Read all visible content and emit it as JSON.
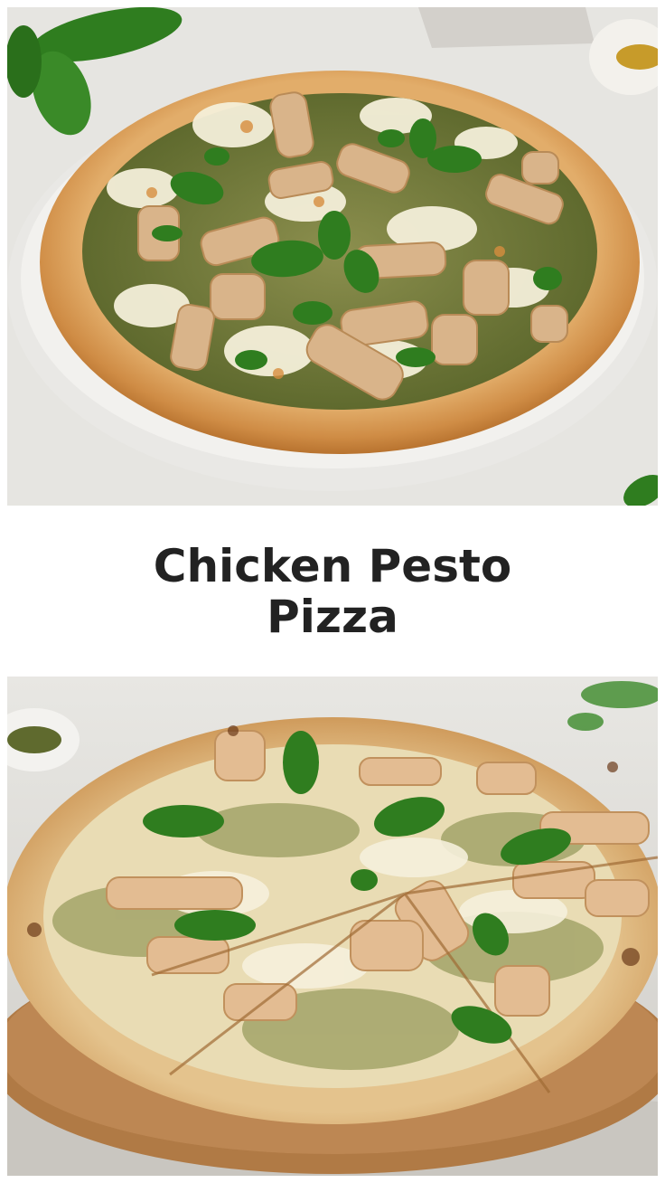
{
  "title": "Chicken Pesto Pizza",
  "images": [
    {
      "name": "top-photo",
      "subject": "pizza-on-white-plate"
    },
    {
      "name": "bottom-photo",
      "subject": "sliced-pizza-on-wooden-board"
    }
  ],
  "colors": {
    "background": "#ffffff",
    "title_text": "#222222",
    "crust": "#d9a25c",
    "pesto": "#6f7a3a",
    "cheese": "#f4efd9",
    "basil": "#2f7d1f",
    "board": "#b07a45"
  }
}
